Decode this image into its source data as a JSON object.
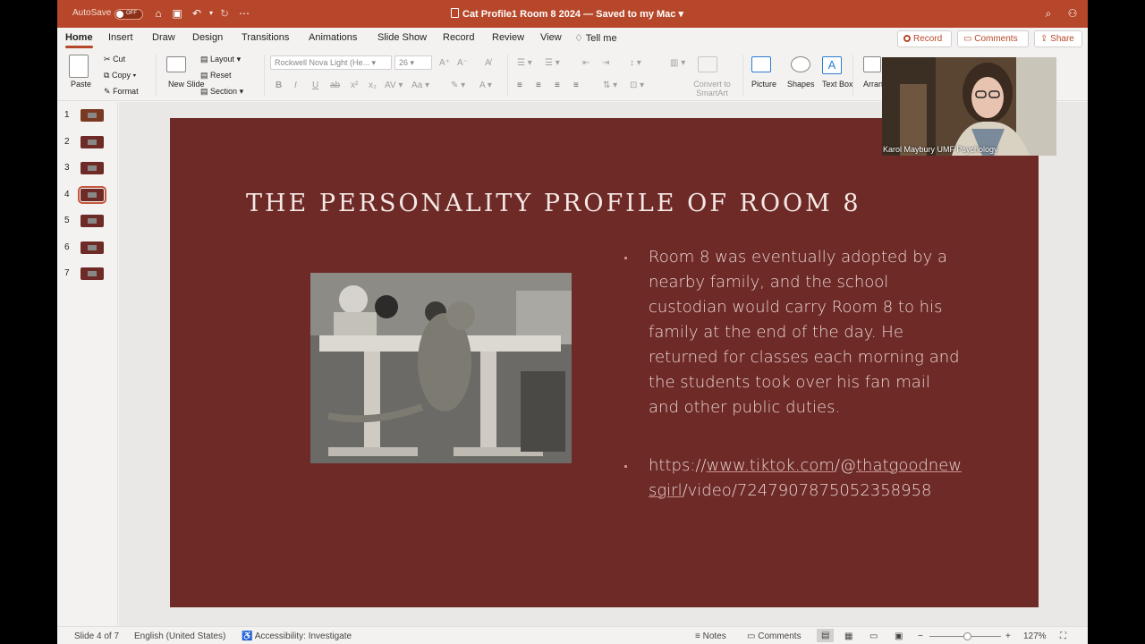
{
  "titlebar": {
    "autosave_label": "AutoSave",
    "autosave_state": "OFF",
    "document_title": "Cat Profile1 Room 8 2024 — Saved to my Mac",
    "accent_color": "#b7472a"
  },
  "tabs": [
    "Home",
    "Insert",
    "Draw",
    "Design",
    "Transitions",
    "Animations",
    "Slide Show",
    "Record",
    "Review",
    "View",
    "Tell me"
  ],
  "active_tab": "Home",
  "header_buttons": {
    "record": "Record",
    "comments": "Comments",
    "share": "Share"
  },
  "ribbon": {
    "paste": "Paste",
    "cut": "Cut",
    "copy": "Copy",
    "format": "Format",
    "new_slide": "New Slide",
    "layout": "Layout",
    "reset": "Reset",
    "section": "Section",
    "font_name": "Rockwell Nova Light (He...",
    "font_size": "26",
    "convert_to_smartart": "Convert to SmartArt",
    "picture": "Picture",
    "shapes": "Shapes",
    "text_box": "Text Box",
    "arrange": "Arran"
  },
  "thumbnails": [
    {
      "num": "1"
    },
    {
      "num": "2"
    },
    {
      "num": "3"
    },
    {
      "num": "4",
      "selected": true
    },
    {
      "num": "5"
    },
    {
      "num": "6"
    },
    {
      "num": "7"
    }
  ],
  "slide": {
    "title": "THE PERSONALITY PROFILE OF ROOM 8",
    "bullet1": "Room 8 was eventually adopted by a nearby family, and the school custodian would carry Room 8 to his family at the end of the day. He returned for classes each morning and the students took over his fan mail and other public duties.",
    "link_parts": [
      "https://",
      "www.tiktok.com",
      "/@",
      "thatgoodnewsgirl",
      "/video/7247907875052358958"
    ],
    "background_color": "#6e2a27"
  },
  "video": {
    "caption": "Karol Maybury UMF Psychology"
  },
  "status": {
    "slide_info": "Slide 4 of 7",
    "language": "English (United States)",
    "accessibility": "Accessibility: Investigate",
    "notes": "Notes",
    "comments": "Comments",
    "zoom": "127%"
  }
}
